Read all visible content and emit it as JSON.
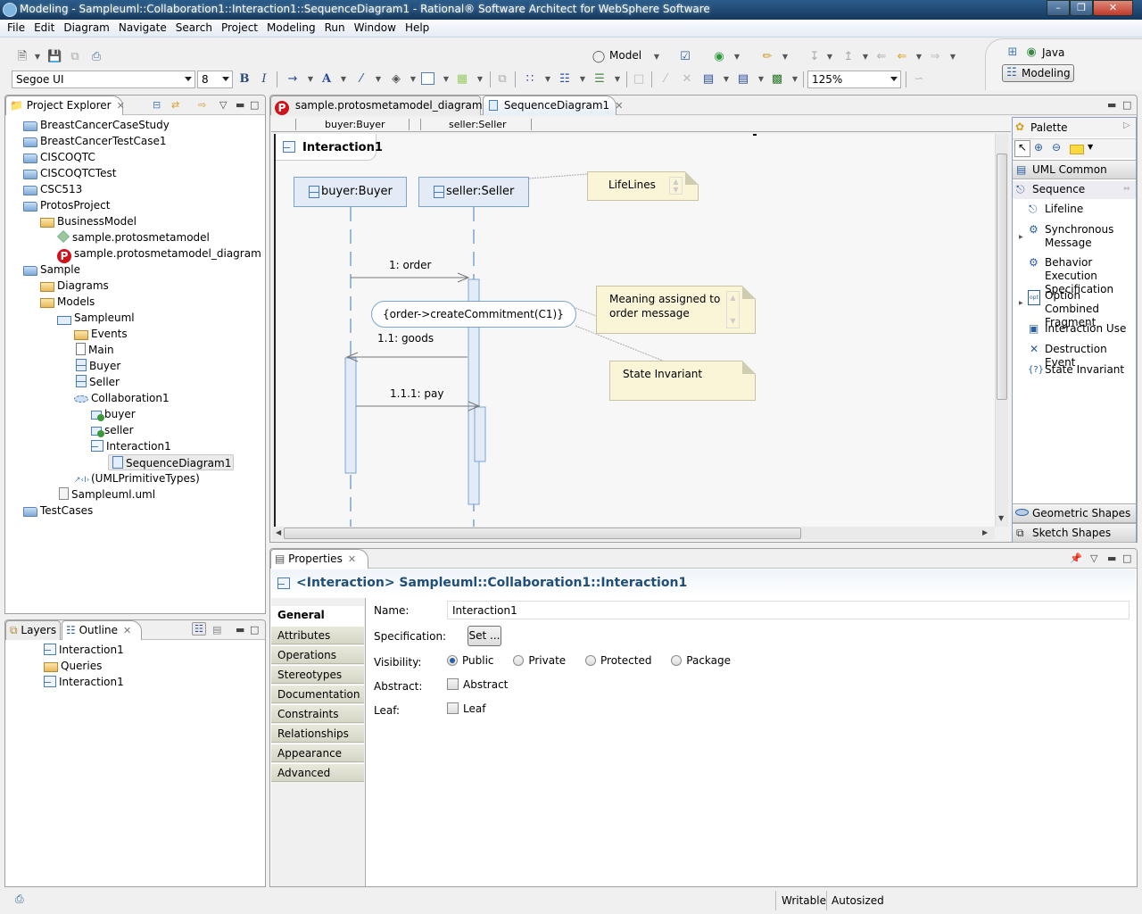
{
  "window": {
    "title": "Modeling - Sampleuml::Collaboration1::Interaction1::SequenceDiagram1 - Rational® Software Architect for WebSphere Software",
    "controls": [
      "minimize",
      "restore",
      "close"
    ]
  },
  "menubar": [
    "File",
    "Edit",
    "Diagram",
    "Navigate",
    "Search",
    "Project",
    "Modeling",
    "Run",
    "Window",
    "Help"
  ],
  "toolbar": {
    "font_family": "Segoe UI",
    "font_size": "8",
    "bold": "B",
    "italic": "I",
    "model_label": "Model",
    "zoom": "125%"
  },
  "perspectives": {
    "java": "Java",
    "modeling": "Modeling"
  },
  "project_explorer": {
    "tab": "Project Explorer",
    "items": [
      {
        "label": "BreastCancerCaseStudy",
        "icon": "project-folder-icon",
        "depth": 0
      },
      {
        "label": "BreastCancerTestCase1",
        "icon": "project-folder-icon",
        "depth": 0
      },
      {
        "label": "CISCOQTC",
        "icon": "project-folder-icon",
        "depth": 0
      },
      {
        "label": "CISCOQTCTest",
        "icon": "project-folder-icon",
        "depth": 0
      },
      {
        "label": "CSC513",
        "icon": "project-folder-icon",
        "depth": 0
      },
      {
        "label": "ProtosProject",
        "icon": "project-folder-icon",
        "depth": 0
      },
      {
        "label": "BusinessModel",
        "icon": "folder-icon",
        "depth": 1
      },
      {
        "label": "sample.protosmetamodel",
        "icon": "model-file-icon",
        "depth": 2
      },
      {
        "label": "sample.protosmetamodel_diagram",
        "icon": "protos-diagram-icon",
        "depth": 2
      },
      {
        "label": "Sample",
        "icon": "project-folder-icon",
        "depth": 0
      },
      {
        "label": "Diagrams",
        "icon": "diagrams-folder-icon",
        "depth": 1
      },
      {
        "label": "Models",
        "icon": "models-folder-icon",
        "depth": 1
      },
      {
        "label": "Sampleuml",
        "icon": "package-icon",
        "depth": 2
      },
      {
        "label": "Events",
        "icon": "events-folder-icon",
        "depth": 3
      },
      {
        "label": "Main",
        "icon": "document-icon",
        "depth": 3
      },
      {
        "label": "Buyer",
        "icon": "class-icon",
        "depth": 3
      },
      {
        "label": "Seller",
        "icon": "class-icon",
        "depth": 3
      },
      {
        "label": "Collaboration1",
        "icon": "collaboration-icon",
        "depth": 3
      },
      {
        "label": "buyer",
        "icon": "part-icon",
        "depth": 4
      },
      {
        "label": "seller",
        "icon": "part-icon",
        "depth": 4
      },
      {
        "label": "Interaction1",
        "icon": "interaction-icon",
        "depth": 4
      },
      {
        "label": "SequenceDiagram1",
        "icon": "sequence-diagram-icon",
        "depth": 5,
        "selected": true
      },
      {
        "label": "(UMLPrimitiveTypes)",
        "icon": "primitive-types-icon",
        "depth": 3
      },
      {
        "label": "Sampleuml.uml",
        "icon": "uml-file-icon",
        "depth": 2
      },
      {
        "label": "TestCases",
        "icon": "project-folder-icon",
        "depth": 0
      }
    ]
  },
  "outline": {
    "tabs": [
      "Layers",
      "Outline"
    ],
    "items": [
      {
        "label": "Interaction1",
        "depth": 0
      },
      {
        "label": "Queries",
        "depth": 1
      },
      {
        "label": "Interaction1",
        "depth": 1
      }
    ]
  },
  "editor": {
    "tabs": [
      {
        "label": "sample.protosmetamodel_diagram",
        "active": false
      },
      {
        "label": "SequenceDiagram1",
        "active": true
      }
    ],
    "ruler_headers": [
      "buyer:Buyer",
      "seller:Seller"
    ],
    "frame_title": "Interaction1",
    "lifelines": [
      "buyer:Buyer",
      "seller:Seller"
    ],
    "messages": [
      "1: order",
      "1.1: goods",
      "1.1.1: pay"
    ],
    "constraint": "{order->createCommitment(C1)}",
    "notes": [
      "LifeLines",
      "Meaning assigned to order message",
      "State Invariant"
    ]
  },
  "palette": {
    "title": "Palette",
    "drawers": {
      "uml_common": "UML Common",
      "sequence": "Sequence",
      "geometric": "Geometric Shapes",
      "sketch": "Sketch Shapes"
    },
    "tools": [
      "Lifeline",
      "Synchronous Message",
      "Behavior Execution Specification",
      "Option Combined Fragment",
      "Interaction Use",
      "Destruction Event",
      "State Invariant"
    ]
  },
  "properties": {
    "tab": "Properties",
    "header": "<Interaction> Sampleuml::Collaboration1::Interaction1",
    "sections": [
      "General",
      "Attributes",
      "Operations",
      "Stereotypes",
      "Documentation",
      "Constraints",
      "Relationships",
      "Appearance",
      "Advanced"
    ],
    "active_section": "General",
    "fields": {
      "name_label": "Name:",
      "name_value": "Interaction1",
      "spec_label": "Specification:",
      "spec_button": "Set ...",
      "visibility_label": "Visibility:",
      "visibility_options": [
        "Public",
        "Private",
        "Protected",
        "Package"
      ],
      "visibility_selected": "Public",
      "abstract_label": "Abstract:",
      "abstract_check": "Abstract",
      "abstract_checked": false,
      "leaf_label": "Leaf:",
      "leaf_check": "Leaf",
      "leaf_checked": false
    }
  },
  "statusbar": {
    "writable": "Writable",
    "autosized": "Autosized"
  }
}
